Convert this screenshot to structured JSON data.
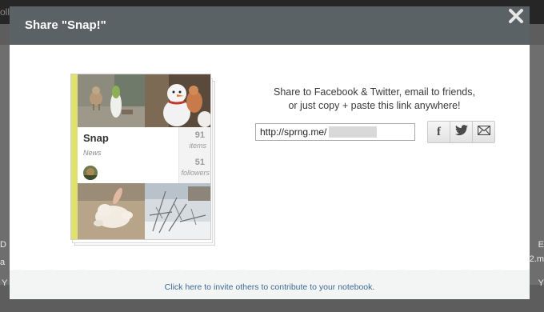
{
  "background_page": {
    "topbar_fragment": "ollo",
    "left_fragments": [
      "D",
      "a",
      "Y"
    ],
    "right_fragments": [
      "E",
      "2.m",
      "Y"
    ]
  },
  "modal": {
    "title": "Share \"Snap!\"",
    "close_icon": "close-x-icon",
    "header_color": "#5b6265"
  },
  "notebook": {
    "title": "Snap",
    "category": "News",
    "items_count": "91",
    "items_label": "items",
    "followers_count": "51",
    "followers_label": "followers",
    "spine_color": "#dfe26e",
    "photos": [
      "dog-and-snowman-photo",
      "snowman-and-dog-photo",
      "rabbit-photo",
      "snowy-trees-photo"
    ]
  },
  "share": {
    "line1": "Share to Facebook & Twitter, email to friends,",
    "line2": "or just copy + paste this link anywhere!",
    "link_value": "http://sprng.me/",
    "buttons": [
      {
        "name": "facebook-icon",
        "glyph": "f"
      },
      {
        "name": "twitter-icon",
        "glyph": ""
      },
      {
        "name": "email-icon",
        "glyph": ""
      }
    ]
  },
  "footer": {
    "invite_text": "Click here to invite others to contribute to your notebook.",
    "link_color": "#3f6a93"
  }
}
